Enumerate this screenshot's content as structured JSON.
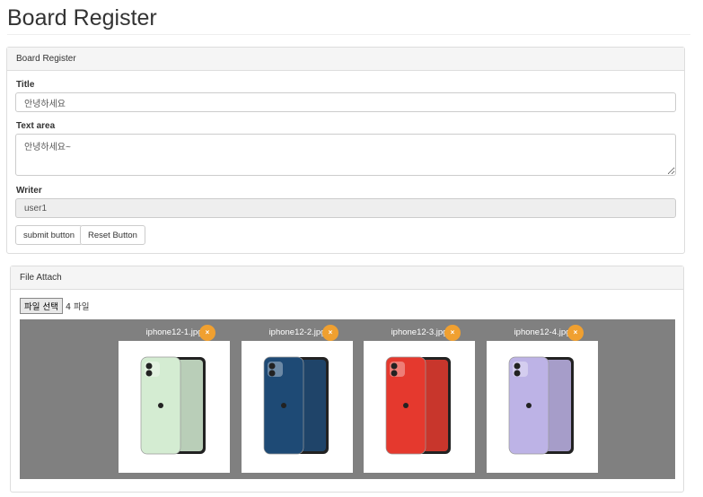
{
  "page_title": "Board Register",
  "register_panel": {
    "header": "Board Register",
    "title_label": "Title",
    "title_value": "안녕하세요",
    "textarea_label": "Text area",
    "textarea_value": "안녕하세요~",
    "writer_label": "Writer",
    "writer_value": "user1",
    "submit_label": "submit button",
    "reset_label": "Reset Button"
  },
  "file_panel": {
    "header": "File Attach",
    "choose_label": "파일 선택",
    "file_count": "4 파일",
    "remove_icon": "×",
    "files": [
      {
        "name": "iphone12-1.jpg",
        "color": "#d4ecd2"
      },
      {
        "name": "iphone12-2.jpg",
        "color": "#1e4a75"
      },
      {
        "name": "iphone12-3.jpg",
        "color": "#e5392e"
      },
      {
        "name": "iphone12-4.jpg",
        "color": "#bdb3e6"
      }
    ]
  }
}
